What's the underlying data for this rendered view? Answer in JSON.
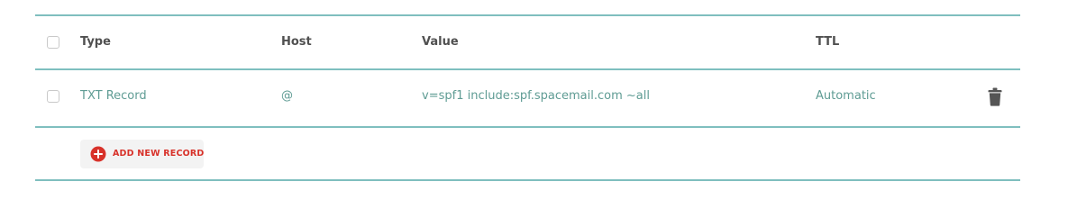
{
  "table": {
    "headers": {
      "type": "Type",
      "host": "Host",
      "value": "Value",
      "ttl": "TTL"
    },
    "rows": [
      {
        "type": "TXT Record",
        "host": "@",
        "value": "v=spf1 include:spf.spacemail.com ~all",
        "ttl": "Automatic"
      }
    ]
  },
  "actions": {
    "add_new_record_label": "ADD NEW RECORD"
  },
  "icons": {
    "delete": "trash-icon",
    "add": "plus-circle-icon"
  },
  "colors": {
    "rule": "#7fbfbf",
    "cell_text": "#5f9c94",
    "header_text": "#505050",
    "add_accent": "#d8322a"
  }
}
